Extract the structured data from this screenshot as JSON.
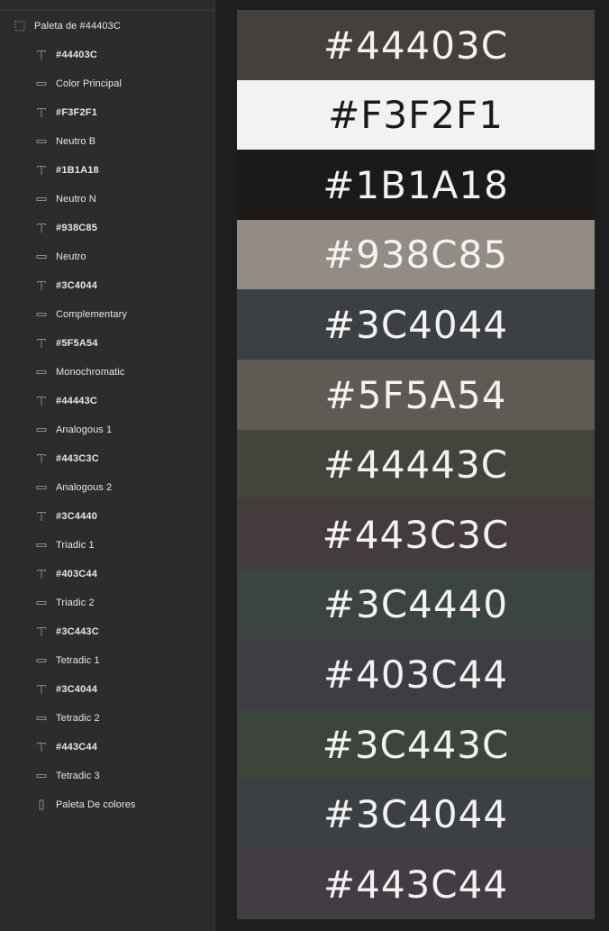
{
  "layers": {
    "root": {
      "label": "Paleta de #44403C",
      "icon": "frame-dashed-icon"
    },
    "items": [
      {
        "type": "text",
        "icon": "text-icon",
        "label": "#44403C"
      },
      {
        "type": "rect",
        "icon": "rectangle-icon",
        "label": "Color Principal"
      },
      {
        "type": "text",
        "icon": "text-icon",
        "label": "#F3F2F1"
      },
      {
        "type": "rect",
        "icon": "rectangle-icon",
        "label": "Neutro B"
      },
      {
        "type": "text",
        "icon": "text-icon",
        "label": "#1B1A18"
      },
      {
        "type": "rect",
        "icon": "rectangle-icon",
        "label": "Neutro N"
      },
      {
        "type": "text",
        "icon": "text-icon",
        "label": "#938C85"
      },
      {
        "type": "rect",
        "icon": "rectangle-icon",
        "label": "Neutro"
      },
      {
        "type": "text",
        "icon": "text-icon",
        "label": "#3C4044"
      },
      {
        "type": "rect",
        "icon": "rectangle-icon",
        "label": "Complementary"
      },
      {
        "type": "text",
        "icon": "text-icon",
        "label": "#5F5A54"
      },
      {
        "type": "rect",
        "icon": "rectangle-icon",
        "label": "Monochromatic"
      },
      {
        "type": "text",
        "icon": "text-icon",
        "label": "#44443C"
      },
      {
        "type": "rect",
        "icon": "rectangle-icon",
        "label": "Analogous 1"
      },
      {
        "type": "text",
        "icon": "text-icon",
        "label": "#443C3C"
      },
      {
        "type": "rect",
        "icon": "rectangle-icon",
        "label": "Analogous 2"
      },
      {
        "type": "text",
        "icon": "text-icon",
        "label": "#3C4440"
      },
      {
        "type": "rect",
        "icon": "rectangle-icon",
        "label": "Triadic 1"
      },
      {
        "type": "text",
        "icon": "text-icon",
        "label": "#403C44"
      },
      {
        "type": "rect",
        "icon": "rectangle-icon",
        "label": "Triadic 2"
      },
      {
        "type": "text",
        "icon": "text-icon",
        "label": "#3C443C"
      },
      {
        "type": "rect",
        "icon": "rectangle-icon",
        "label": "Tetradic 1"
      },
      {
        "type": "text",
        "icon": "text-icon",
        "label": "#3C4044"
      },
      {
        "type": "rect",
        "icon": "rectangle-icon",
        "label": "Tetradic 2"
      },
      {
        "type": "text",
        "icon": "text-icon",
        "label": "#443C44"
      },
      {
        "type": "rect",
        "icon": "rectangle-icon",
        "label": "Tetradic 3"
      },
      {
        "type": "group",
        "icon": "group-icon",
        "label": "Paleta De colores"
      }
    ]
  },
  "swatches": [
    {
      "label": "#44403C",
      "bg": "#44403C",
      "fg": "#F3F2F1"
    },
    {
      "label": "#F3F2F1",
      "bg": "#F3F2F1",
      "fg": "#1B1A18"
    },
    {
      "label": "#1B1A18",
      "bg": "#1B1A18",
      "fg": "#F3F2F1"
    },
    {
      "label": "#938C85",
      "bg": "#938C85",
      "fg": "#F3F2F1"
    },
    {
      "label": "#3C4044",
      "bg": "#3C4044",
      "fg": "#F3F2F1"
    },
    {
      "label": "#5F5A54",
      "bg": "#5F5A54",
      "fg": "#F3F2F1"
    },
    {
      "label": "#44443C",
      "bg": "#44443C",
      "fg": "#F3F2F1"
    },
    {
      "label": "#443C3C",
      "bg": "#443C3C",
      "fg": "#F3F2F1"
    },
    {
      "label": "#3C4440",
      "bg": "#3C4440",
      "fg": "#F3F2F1"
    },
    {
      "label": "#403C44",
      "bg": "#403C44",
      "fg": "#F3F2F1"
    },
    {
      "label": "#3C443C",
      "bg": "#3C443C",
      "fg": "#F3F2F1"
    },
    {
      "label": "#3C4044",
      "bg": "#3C4044",
      "fg": "#F3F2F1"
    },
    {
      "label": "#443C44",
      "bg": "#443C44",
      "fg": "#F3F2F1"
    }
  ],
  "colors": {
    "panel_bg": "#2C2C2C",
    "canvas_bg": "#1E1E1E",
    "icon": "#8A8A8A"
  }
}
